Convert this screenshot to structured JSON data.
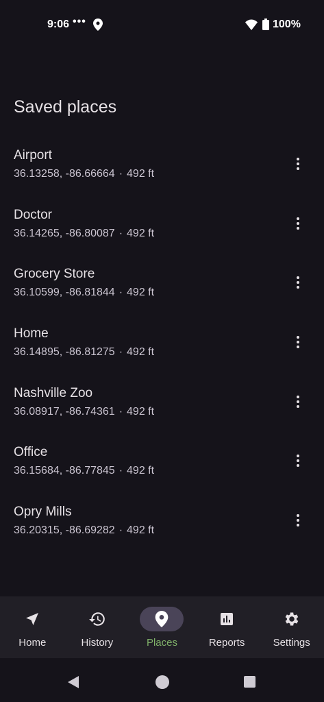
{
  "status_bar": {
    "time": "9:06",
    "dots": "•••",
    "battery": "100%"
  },
  "page": {
    "title": "Saved places"
  },
  "places": [
    {
      "name": "Airport",
      "coords": "36.13258, -86.66664",
      "altitude": "492 ft"
    },
    {
      "name": "Doctor",
      "coords": "36.14265, -86.80087",
      "altitude": "492 ft"
    },
    {
      "name": "Grocery Store",
      "coords": "36.10599, -86.81844",
      "altitude": "492 ft"
    },
    {
      "name": "Home",
      "coords": "36.14895, -86.81275",
      "altitude": "492 ft"
    },
    {
      "name": "Nashville Zoo",
      "coords": "36.08917, -86.74361",
      "altitude": "492 ft"
    },
    {
      "name": "Office",
      "coords": "36.15684, -86.77845",
      "altitude": "492 ft"
    },
    {
      "name": "Opry Mills",
      "coords": "36.20315, -86.69282",
      "altitude": "492 ft"
    }
  ],
  "separator": "·",
  "bottom_nav": {
    "items": [
      {
        "label": "Home",
        "icon": "navigation-arrow-icon"
      },
      {
        "label": "History",
        "icon": "history-icon"
      },
      {
        "label": "Places",
        "icon": "place-pin-icon",
        "active": true
      },
      {
        "label": "Reports",
        "icon": "bar-chart-icon"
      },
      {
        "label": "Settings",
        "icon": "gear-icon"
      }
    ]
  },
  "colors": {
    "background": "#15131a",
    "nav_background": "#211f26",
    "active_pill": "#4a4458",
    "active_label": "#7fb069"
  }
}
